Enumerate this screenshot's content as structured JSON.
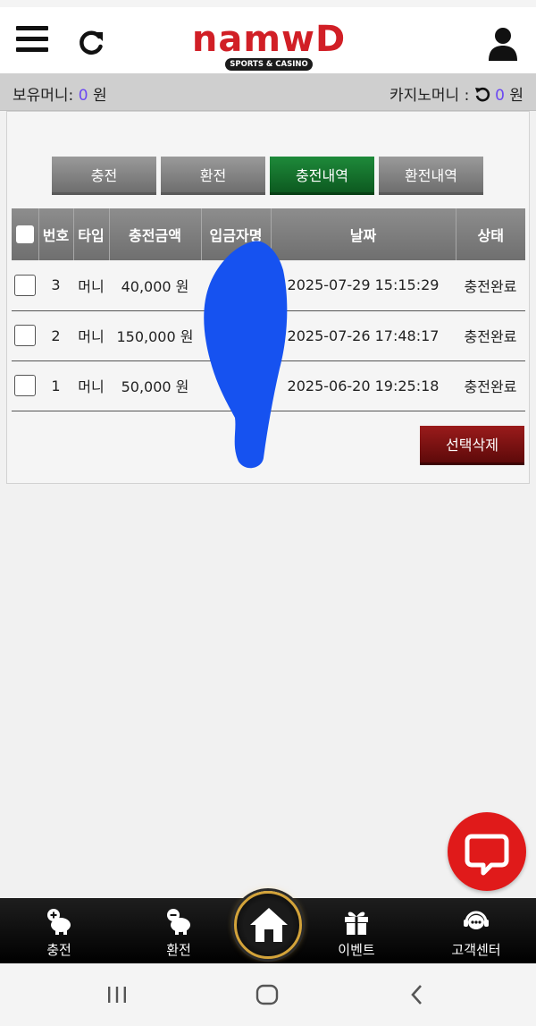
{
  "brand": {
    "logo": "namwD",
    "tagline": "SPORTS & CASINO"
  },
  "header": {
    "menu_icon": "hamburger-menu-icon",
    "refresh_icon": "refresh-icon",
    "user_icon": "user-icon"
  },
  "balance": {
    "money_label": "보유머니:",
    "money_value": "0",
    "money_unit": "원",
    "casino_label": "카지노머니 :",
    "casino_value": "0",
    "casino_unit": "원"
  },
  "tabs": [
    {
      "label": "충전",
      "active": false
    },
    {
      "label": "환전",
      "active": false
    },
    {
      "label": "충전내역",
      "active": true
    },
    {
      "label": "환전내역",
      "active": false
    }
  ],
  "table": {
    "headers": [
      "번호",
      "타입",
      "충전금액",
      "입금자명",
      "날짜",
      "상태"
    ],
    "rows": [
      {
        "no": "3",
        "type": "머니",
        "amount": "40,000 원",
        "depositor": "",
        "date": "2025-07-29 15:15:29",
        "status": "충전완료"
      },
      {
        "no": "2",
        "type": "머니",
        "amount": "150,000 원",
        "depositor": "",
        "date": "2025-07-26 17:48:17",
        "status": "충전완료"
      },
      {
        "no": "1",
        "type": "머니",
        "amount": "50,000 원",
        "depositor": "",
        "date": "2025-06-20 19:25:18",
        "status": "충전완료"
      }
    ]
  },
  "delete_button": "선택삭제",
  "bottom_nav": {
    "deposit": "충전",
    "withdraw": "환전",
    "event": "이벤트",
    "support": "고객센터"
  },
  "colors": {
    "accent_purple": "#6b48f2",
    "active_tab_green": "#1e8a3a",
    "delete_red": "#9a1b1b",
    "chat_red": "#e01a1a",
    "brand_red": "#d11f26"
  }
}
